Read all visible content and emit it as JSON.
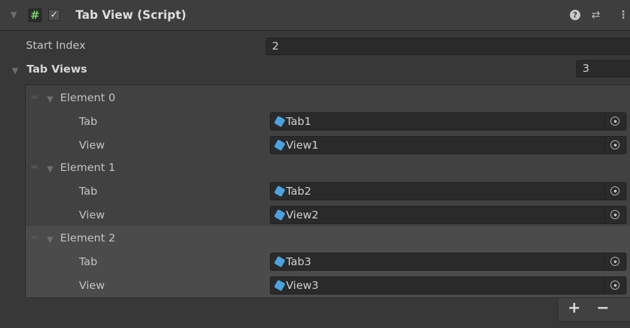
{
  "component": {
    "title": "Tab View (Script)",
    "enabled": true,
    "icons": [
      "foldout-arrow-icon",
      "csharp-script-icon",
      "enabled-checkbox",
      "help-icon",
      "preset-icon",
      "kebab-menu-icon"
    ]
  },
  "properties": {
    "start_index": {
      "label": "Start Index",
      "value": "2"
    },
    "tab_views": {
      "label": "Tab Views",
      "size": "3"
    }
  },
  "elements": [
    {
      "label": "Element 0",
      "tab_label": "Tab",
      "tab_value": "Tab1",
      "view_label": "View",
      "view_value": "View1"
    },
    {
      "label": "Element 1",
      "tab_label": "Tab",
      "tab_value": "Tab2",
      "view_label": "View",
      "view_value": "View2"
    },
    {
      "label": "Element 2",
      "tab_label": "Tab",
      "tab_value": "Tab3",
      "view_label": "View",
      "view_value": "View3",
      "selected": true
    }
  ],
  "footer": {
    "add_label": "+",
    "remove_label": "−"
  },
  "colors": {
    "background": "#383838",
    "field": "#2a2a2a",
    "list": "#414141",
    "selected_row": "#4b4b4b",
    "script_icon": "#7ad36b",
    "object_icon": "#4aa3e0"
  }
}
